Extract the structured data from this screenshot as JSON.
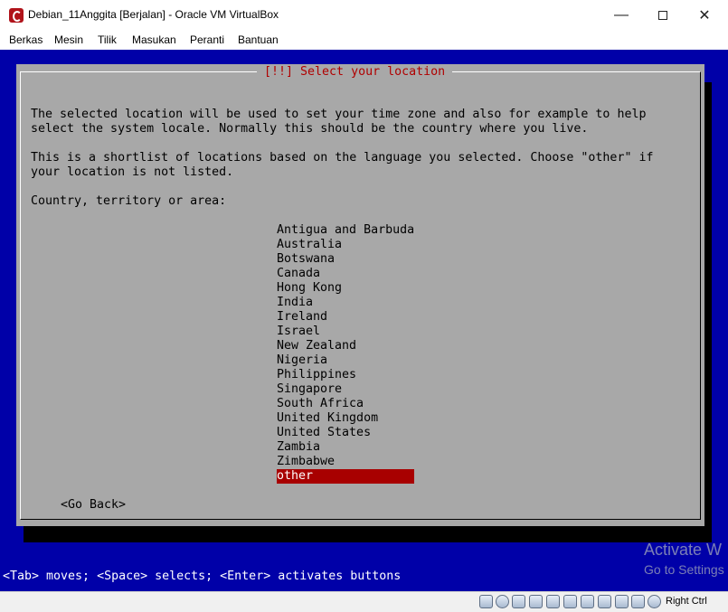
{
  "window": {
    "title": "Debian_11Anggita [Berjalan] - Oracle VM VirtualBox",
    "minimize_glyph": "—",
    "close_glyph": "✕"
  },
  "menu": [
    "Berkas",
    "Mesin",
    "Tilik",
    "Masukan",
    "Peranti",
    "Bantuan"
  ],
  "dialog": {
    "title": "[!!] Select your location",
    "paragraph1_line1": "The selected location will be used to set your time zone and also for example to help",
    "paragraph1_line2": "select the system locale. Normally this should be the country where you live.",
    "paragraph2_line1": "This is a shortlist of locations based on the language you selected. Choose \"other\" if",
    "paragraph2_line2": "your location is not listed.",
    "prompt": "Country, territory or area:",
    "options": [
      "Antigua and Barbuda",
      "Australia",
      "Botswana",
      "Canada",
      "Hong Kong",
      "India",
      "Ireland",
      "Israel",
      "New Zealand",
      "Nigeria",
      "Philippines",
      "Singapore",
      "South Africa",
      "United Kingdom",
      "United States",
      "Zambia",
      "Zimbabwe",
      "other"
    ],
    "selected_option": "other",
    "go_back": "<Go Back>"
  },
  "hint": "<Tab> moves; <Space> selects; <Enter> activates buttons",
  "watermark": {
    "line1": "Activate W",
    "line2": "Go to Settings"
  },
  "statusbar": {
    "icons": [
      "hard-disk-icon",
      "optical-drive-icon",
      "audio-icon",
      "network-icon",
      "usb-icon",
      "shared-folders-icon",
      "display-icon",
      "video-capture-icon",
      "recording-icon",
      "cpu-icon",
      "arrow-icon",
      "mouse-integration-icon"
    ],
    "host_key": "Right Ctrl"
  },
  "colors": {
    "vm_background": "#0000a8",
    "dialog_background": "#a8a8a8",
    "selection": "#a80000",
    "title_text": "#b00000"
  }
}
